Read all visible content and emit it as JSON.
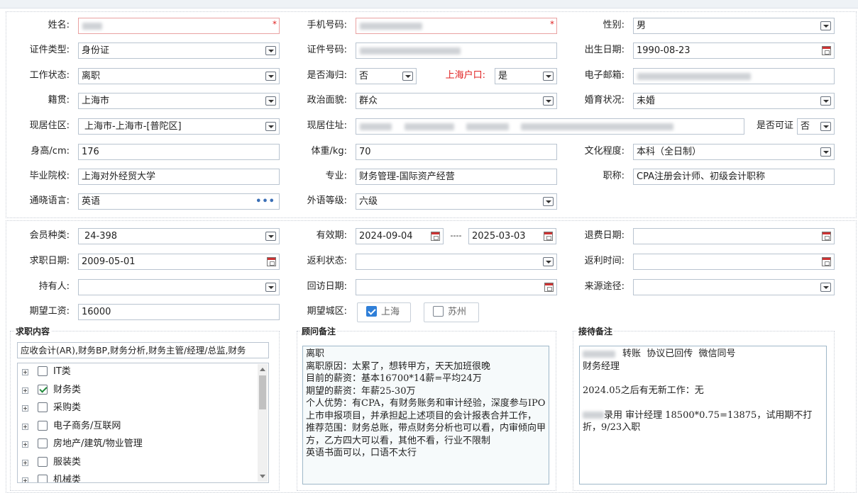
{
  "personal": {
    "name_label": "姓名:",
    "phone_label": "手机号码:",
    "gender_label": "性别:",
    "gender": "男",
    "id_type_label": "证件类型:",
    "id_type": "身份证",
    "id_no_label": "证件号码:",
    "birth_label": "出生日期:",
    "birth": "1990-08-23",
    "work_status_label": "工作状态:",
    "work_status": "离职",
    "returnee_label": "是否海归:",
    "returnee": "否",
    "hukou_label": "上海户口:",
    "hukou": "是",
    "email_label": "电子邮箱:",
    "native_label": "籍贯:",
    "native": "上海市",
    "politics_label": "政治面貌:",
    "politics": "群众",
    "marital_label": "婚育状况:",
    "marital": "未婚",
    "residence_area_label": "现居住区:",
    "residence_area": "上海市-上海市-[普陀区]",
    "address_label": "现居住址:",
    "can_certify_label": "是否可证",
    "can_certify": "否",
    "height_label": "身高/cm:",
    "height": "176",
    "weight_label": "体重/kg:",
    "weight": "70",
    "education_label": "文化程度:",
    "education": "本科（全日制）",
    "school_label": "毕业院校:",
    "school": "上海对外经贸大学",
    "major_label": "专业:",
    "major": "财务管理-国际资产经营",
    "title_label": "职称:",
    "title": "CPA注册会计师、初级会计职称",
    "language_label": "通晓语言:",
    "language": "英语",
    "language_level_label": "外语等级:",
    "language_level": "六级"
  },
  "membership": {
    "member_type_label": "会员种类:",
    "member_type": "24-398",
    "valid_label": "有效期:",
    "valid_from": "2024-09-04",
    "valid_sep": "----",
    "valid_to": "2025-03-03",
    "refund_date_label": "退费日期:",
    "job_date_label": "求职日期:",
    "job_date": "2009-05-01",
    "rebate_status_label": "返利状态:",
    "rebate_time_label": "返利时间:",
    "holder_label": "持有人:",
    "visit_date_label": "回访日期:",
    "source_label": "来源途径:",
    "salary_label": "期望工资:",
    "salary": "16000",
    "city_label": "期望城区:",
    "cities": [
      {
        "name": "上海",
        "checked": true
      },
      {
        "name": "苏州",
        "checked": false
      }
    ]
  },
  "job_content": {
    "title": "求职内容",
    "summary": "应收会计(AR),财务BP,财务分析,财务主管/经理/总监,财务",
    "tree": [
      {
        "label": "IT类",
        "checked": false
      },
      {
        "label": "财务类",
        "checked": true
      },
      {
        "label": "采购类",
        "checked": false
      },
      {
        "label": "电子商务/互联网",
        "checked": false
      },
      {
        "label": "房地产/建筑/物业管理",
        "checked": false
      },
      {
        "label": "服装类",
        "checked": false
      },
      {
        "label": "机械类",
        "checked": false
      }
    ]
  },
  "advisor_notes": {
    "title": "顾问备注",
    "text": "离职\n离职原因：太累了，想转甲方，天天加班很晚\n目前的薪资：基本16700*14薪=平均24万\n期望的薪资：年薪25-30万\n个人优势：有CPA，有财务账务和审计经验，深度参与IPO上市申报项目，并承担起上述项目的会计报表合并工作，\n推荐范围：财务总账，带点财务分析也可以看，内审倾向甲方，乙方四大可以看，其他不看，行业不限制\n英语书面可以，口语不太行"
  },
  "reception_notes": {
    "title": "接待备注",
    "line1": "转账  协议已回传  微信同号",
    "line2": "财务经理",
    "line3": "2024.05之后有无新工作：无",
    "line4": "录用 审计经理  18500*0.75=13875，试用期不打折，9/23入职"
  }
}
